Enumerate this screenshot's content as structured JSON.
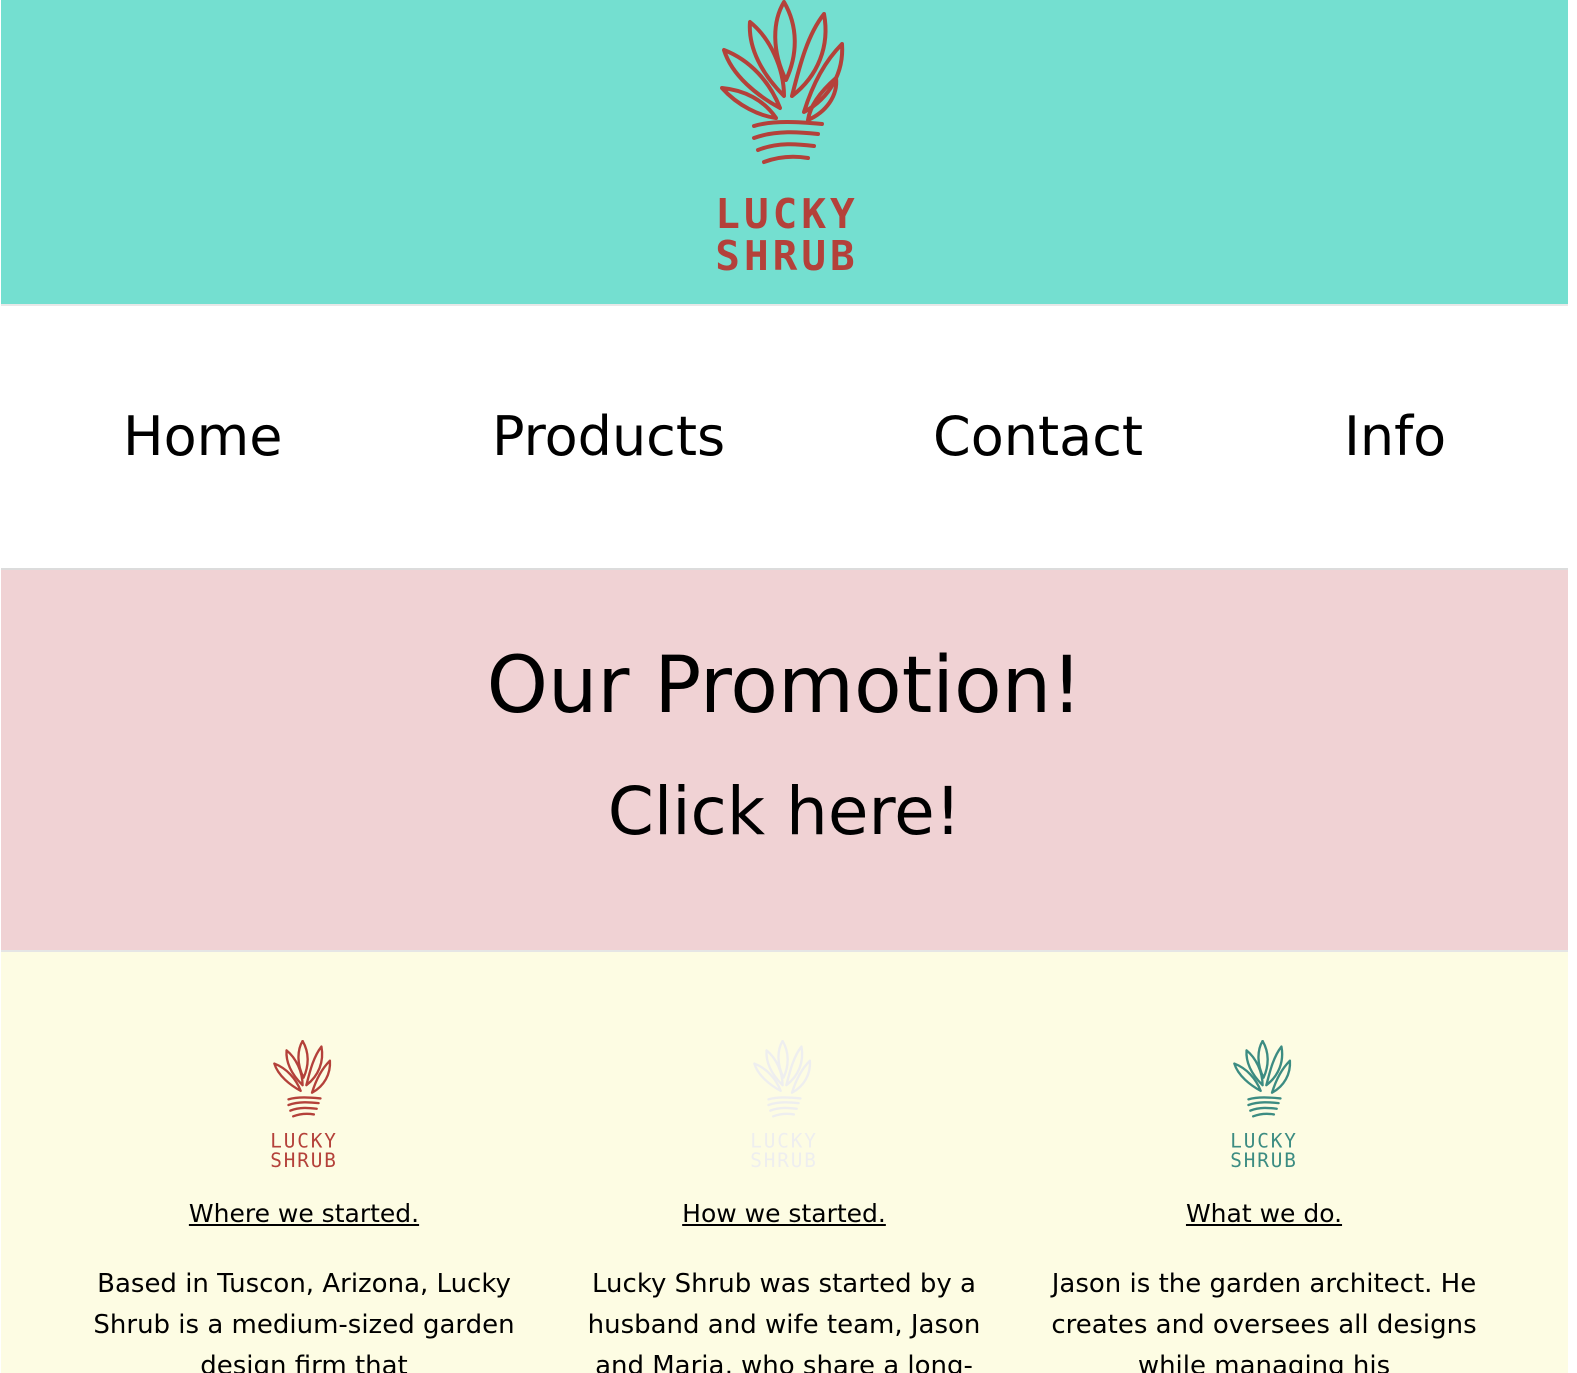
{
  "brand": {
    "line1": "LUCKY",
    "line2": "SHRUB",
    "colors": {
      "primary": "#b4413a",
      "light": "#eeeeef",
      "teal": "#3c8c82"
    }
  },
  "nav": {
    "items": [
      {
        "label": "Home"
      },
      {
        "label": "Products"
      },
      {
        "label": "Contact"
      },
      {
        "label": "Info"
      }
    ]
  },
  "promo": {
    "title": "Our Promotion!",
    "cta": "Click here!"
  },
  "about": {
    "cards": [
      {
        "heading": "Where we started.",
        "text": "Based in Tuscon, Arizona, Lucky Shrub is a medium-sized garden design firm that"
      },
      {
        "heading": "How we started.",
        "text": "Lucky Shrub was started by a husband and wife team, Jason and Maria, who share a long-"
      },
      {
        "heading": "What we do.",
        "text": "Jason is the garden architect. He creates and oversees all designs while managing his"
      }
    ]
  },
  "colors": {
    "header_bg": "#74dfd0",
    "nav_bg": "#ffffff",
    "promo_bg": "#f0d2d4",
    "about_bg": "#fdfce3"
  }
}
